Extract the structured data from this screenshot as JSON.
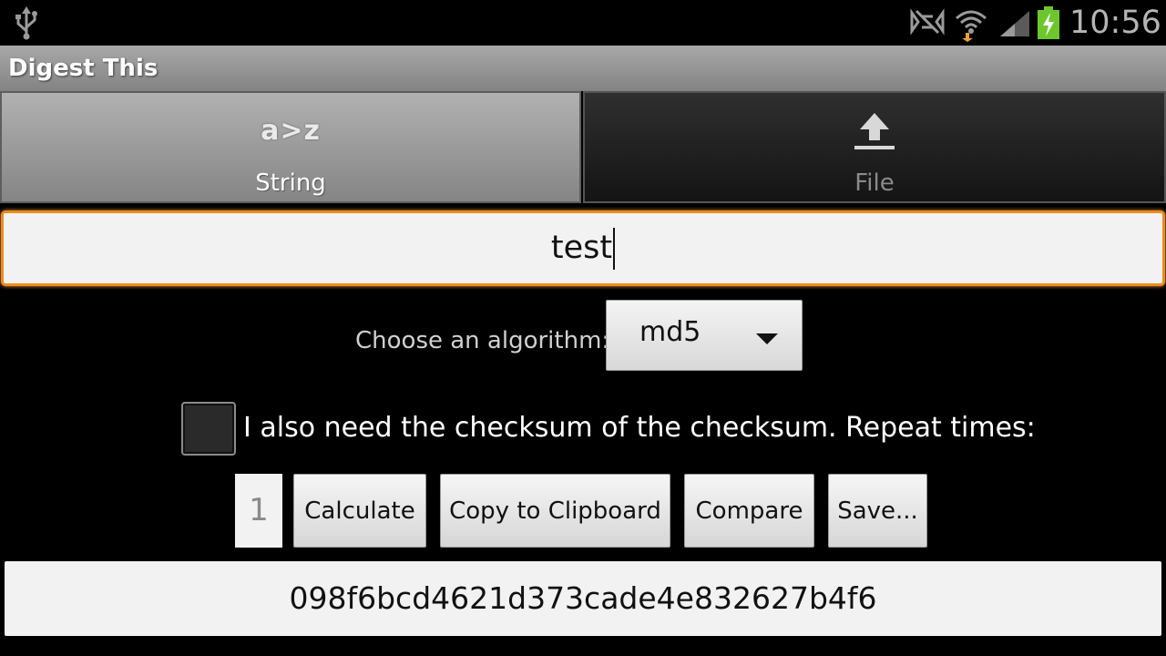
{
  "status_bar": {
    "time": "10:56",
    "icons": [
      "usb-icon",
      "no-signal-icon",
      "wifi-icon",
      "cell-signal-icon",
      "battery-charging-icon"
    ],
    "accent_colors": {
      "battery": "#6ec62d",
      "wifi_arrow": "#f0a030"
    }
  },
  "app": {
    "title": "Digest This"
  },
  "tabs": [
    {
      "label": "String",
      "icon": "a>z",
      "selected": true
    },
    {
      "label": "File",
      "icon": "upload-icon",
      "selected": false
    }
  ],
  "input": {
    "value": "test",
    "focus_color": "#f08b1d"
  },
  "algorithm": {
    "label": "Choose an algorithm:",
    "selected": "md5"
  },
  "checksum_option": {
    "label": "I also need the checksum of the checksum. Repeat times:",
    "checked": false
  },
  "repeat": {
    "value": "1"
  },
  "buttons": {
    "calculate": "Calculate",
    "copy": "Copy to Clipboard",
    "compare": "Compare",
    "save": "Save..."
  },
  "result": {
    "value": "098f6bcd4621d373cade4e832627b4f6"
  }
}
